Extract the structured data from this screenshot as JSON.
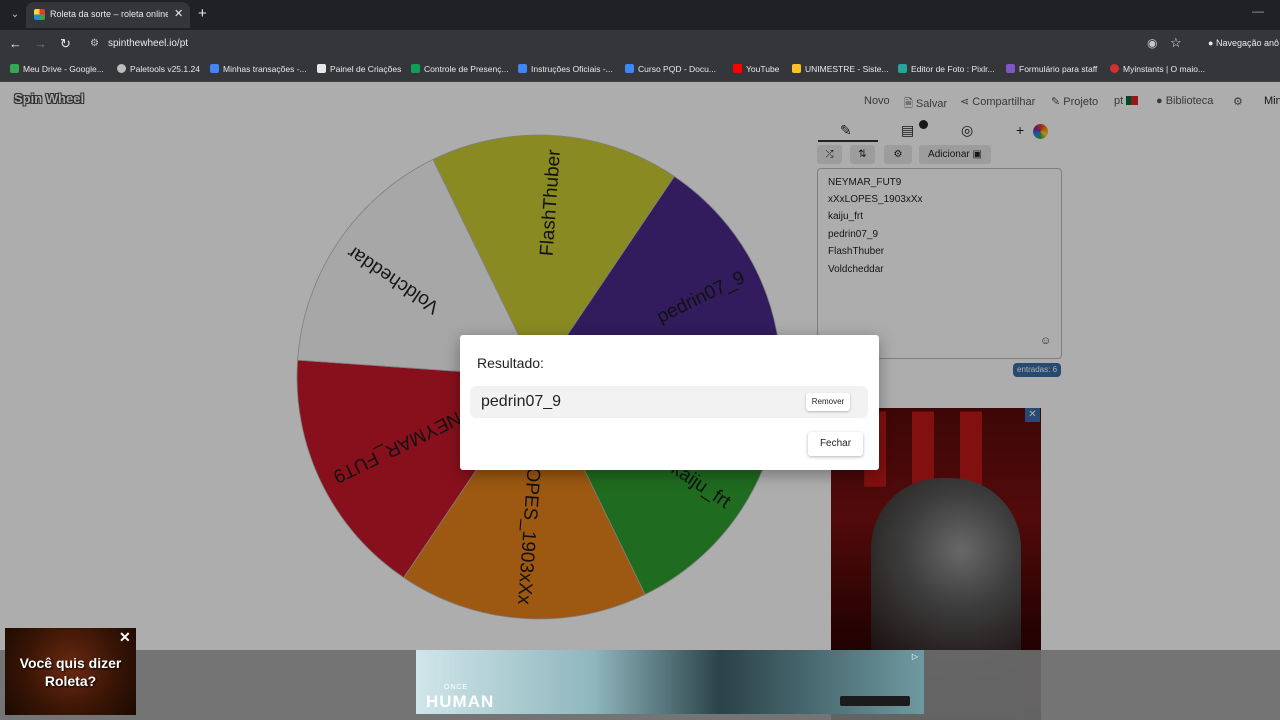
{
  "browser": {
    "tab_title": "Roleta da sorte – roleta online g",
    "url": "spinthewheel.io/pt",
    "incognito_label": "Navegação anô",
    "bookmarks": [
      {
        "label": "Meu Drive - Google...",
        "color": "#34a853"
      },
      {
        "label": "Paletools v25.1.24",
        "color": "#bdbdbd"
      },
      {
        "label": "Minhas transações -...",
        "color": "#4285f4"
      },
      {
        "label": "Painel de Criações",
        "color": "#e8e8e8"
      },
      {
        "label": "Controle de Presenç...",
        "color": "#0f9d58"
      },
      {
        "label": "Instruções Oficiais -...",
        "color": "#4285f4"
      },
      {
        "label": "Curso PQD - Docu...",
        "color": "#4285f4"
      },
      {
        "label": "YouTube",
        "color": "#ff0000"
      },
      {
        "label": "UNIMESTRE - Siste...",
        "color": "#fbc02d"
      },
      {
        "label": "Editor de Foto : Pixlr...",
        "color": "#26a69a"
      },
      {
        "label": "Formulário para staff",
        "color": "#7e57c2"
      },
      {
        "label": "Myinstants | O maio...",
        "color": "#d32f2f"
      }
    ]
  },
  "app": {
    "logo": "Spin Wheel",
    "nav": {
      "novo": "Novo",
      "salvar": "Salvar",
      "compartilhar": "Compartilhar",
      "projeto": "Projeto",
      "lang": "pt",
      "biblioteca": "Biblioteca",
      "min": "Mini"
    },
    "toolbar": {
      "adicionar": "Adicionar"
    },
    "entries": [
      "NEYMAR_FUT9",
      "xXxLOPES_1903xXx",
      "kaiju_frt",
      "pedrin07_9",
      "FlashThuber",
      "Voldcheddar"
    ],
    "entries_count": "entradas: 6"
  },
  "wheel": {
    "segments": [
      {
        "label": "FlashThuber",
        "color": "#cccc33"
      },
      {
        "label": "pedrin07_9",
        "color": "#4a2a8a"
      },
      {
        "label": "kaiju_frt",
        "color": "#2e9e2e"
      },
      {
        "label": "xXxLOPES_1903xXx",
        "color": "#e8821a"
      },
      {
        "label": "NEYMAR_FUT9",
        "color": "#c8182a"
      },
      {
        "label": "Voldcheddar",
        "color": "#f6f6f6"
      }
    ]
  },
  "dialog": {
    "title": "Resultado:",
    "result": "pedrin07_9",
    "remove_label": "Remover",
    "close_label": "Fechar"
  },
  "ads": {
    "left_text": "Você quis dizer Roleta?",
    "bottom_once": "ONCE",
    "bottom_human": "HUMAN"
  }
}
